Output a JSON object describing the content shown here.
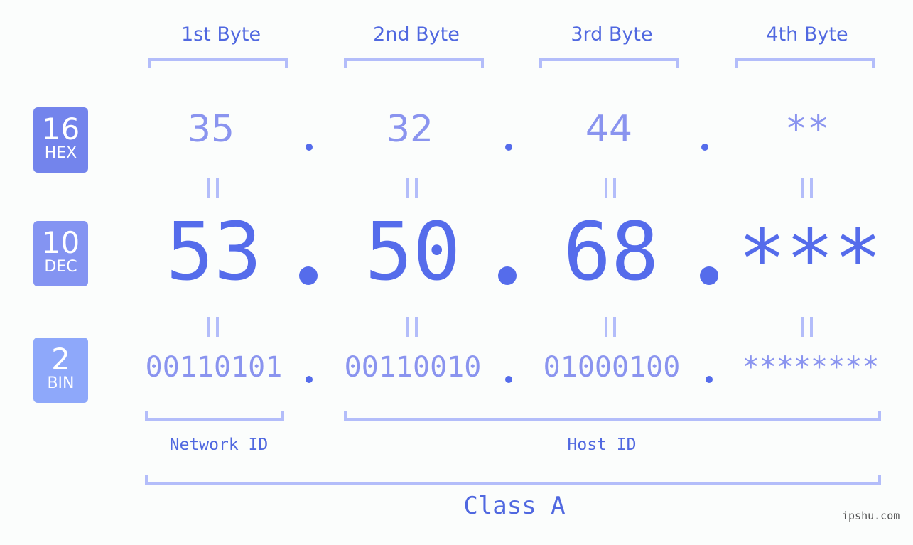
{
  "byte_headers": [
    "1st Byte",
    "2nd Byte",
    "3rd Byte",
    "4th Byte"
  ],
  "badges": {
    "hex": {
      "num": "16",
      "label": "HEX",
      "color": "#7384ec"
    },
    "dec": {
      "num": "10",
      "label": "DEC",
      "color": "#8494f2"
    },
    "bin": {
      "num": "2",
      "label": "BIN",
      "color": "#8ea8fa"
    }
  },
  "hex_values": [
    "35",
    "32",
    "44",
    "**"
  ],
  "dec_values": [
    "53",
    "50",
    "68",
    "***"
  ],
  "bin_values": [
    "00110101",
    "00110010",
    "01000100",
    "********"
  ],
  "separator": ".",
  "network_id_label": "Network ID",
  "host_id_label": "Host ID",
  "class_label": "Class A",
  "watermark": "ipshu.com",
  "colors": {
    "accent": "#556ceb",
    "light_accent": "#8a94ef",
    "bracket": "#b3bdfa",
    "background": "#fbfdfc"
  }
}
